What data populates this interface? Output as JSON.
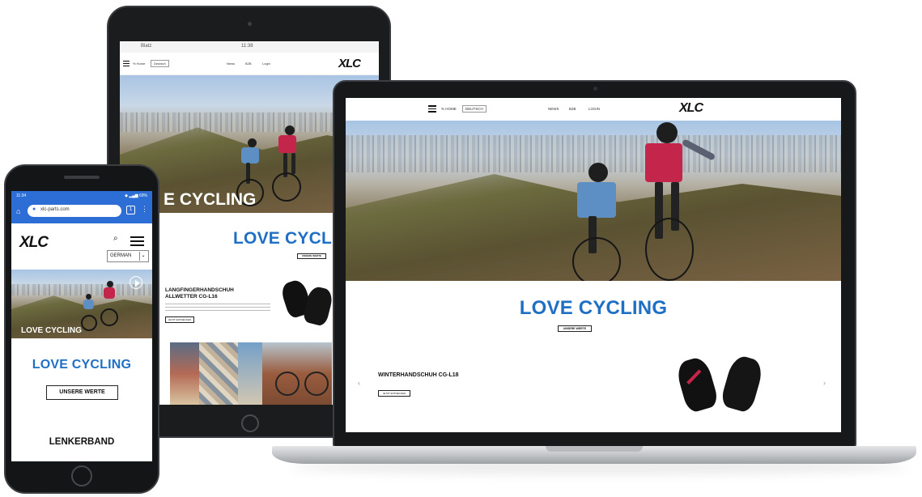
{
  "brand": {
    "logo_text": "XLC"
  },
  "laptop": {
    "nav": {
      "menu_label": "% HOME",
      "lang_label": "DEUTSCH",
      "links": [
        "NEWS",
        "B2B",
        "LOGIN"
      ]
    },
    "hero_headline": "LOVE CYCLING",
    "values_button": "UNSERE WERTE",
    "product": {
      "title": "WINTERHANDSCHUH CG-L18",
      "button": "JETZT ENTDECKEN"
    },
    "arrows": {
      "prev": "‹",
      "next": "›"
    }
  },
  "tablet": {
    "status": {
      "carrier": "Blatz",
      "time": "11:38"
    },
    "nav": {
      "menu_label": "% Home",
      "lang_label": "Deutsch",
      "links": [
        "News",
        "B2B",
        "Login"
      ]
    },
    "hero_overlay": "E CYCLING",
    "hero_headline": "LOVE CYCLING",
    "values_button": "UNSERE WERTE",
    "product": {
      "title_line1": "LANGFINGERHANDSCHUH",
      "title_line2": "ALLWETTER CG-L16",
      "button": "JETZT ENTDECKEN"
    }
  },
  "phone": {
    "status": {
      "time": "11:34",
      "right": "◆ ▂▄▆ 69%"
    },
    "url": "xlc-parts.com",
    "language": "GERMAN",
    "hero_overlay": "LOVE CYCLING",
    "hero_headline": "LOVE CYCLING",
    "values_button": "UNSERE WERTE",
    "section_title": "LENKERBAND"
  },
  "colors": {
    "accent": "#1f6fc4",
    "jersey_red": "#c4264b",
    "jersey_blue": "#5e8fc4"
  },
  "icons": [
    "hamburger-icon",
    "search-icon",
    "home-icon",
    "lock-icon",
    "play-icon",
    "chevron-down-icon"
  ]
}
